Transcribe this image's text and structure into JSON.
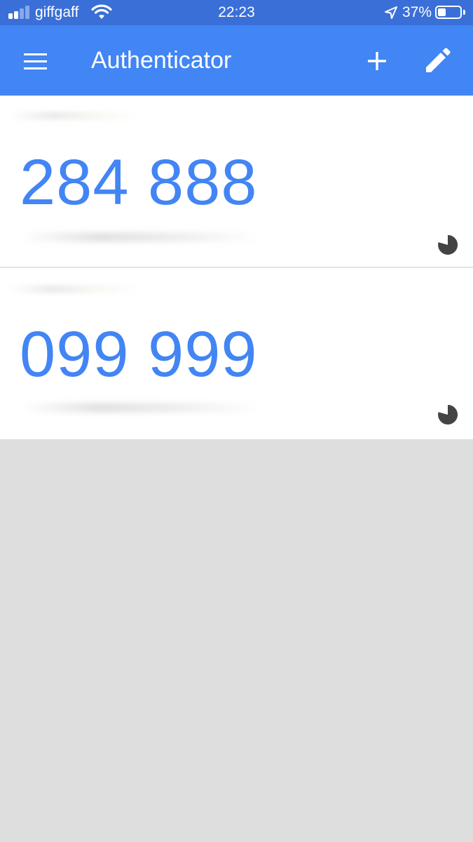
{
  "status_bar": {
    "carrier": "giffgaff",
    "time": "22:23",
    "battery_percent": "37%",
    "battery_level": 0.37,
    "signal_bars_active": 2,
    "signal_bars_total": 4,
    "icons": [
      "signal-icon",
      "wifi-icon",
      "location-arrow-icon",
      "battery-icon"
    ]
  },
  "app_bar": {
    "title": "Authenticator",
    "menu_icon": "hamburger-menu-icon",
    "add_icon": "plus-icon",
    "edit_icon": "pencil-icon",
    "color": "#4285f4"
  },
  "accounts": [
    {
      "code": "284 888",
      "timer_icon": "countdown-pie-icon"
    },
    {
      "code": "099 999",
      "timer_icon": "countdown-pie-icon"
    }
  ],
  "colors": {
    "status_bar": "#3a6fd8",
    "accent": "#4285f4",
    "background": "#dedede",
    "card": "#ffffff",
    "timer": "#444444"
  }
}
